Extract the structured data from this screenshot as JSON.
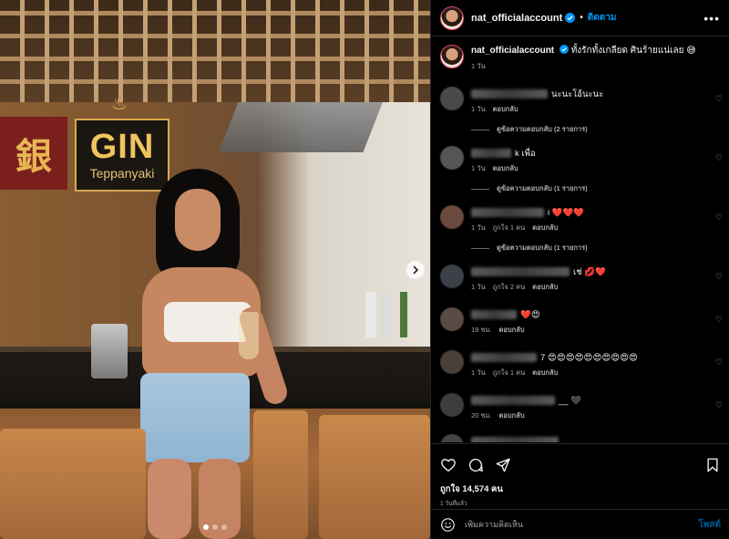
{
  "photo": {
    "sign_left_glyph": "銀",
    "sign_brand": "GIN",
    "sign_sub": "Teppanyaki",
    "carousel_dots": 3,
    "active_dot": 0,
    "next_icon": "chevron-right-icon"
  },
  "header": {
    "username": "nat_officialaccount",
    "separator": "•",
    "follow_label": "ติดตาม",
    "more_icon": "more-horizontal-icon"
  },
  "caption": {
    "username": "nat_officialaccount",
    "text": "ทั้งรักทั้งเกลียด ศินร้ายแน่เลย 😅",
    "time": "1 วัน"
  },
  "comments": [
    {
      "text": "นะนะโอ้นะนะ",
      "time": "1 วัน",
      "likes": "",
      "reply_label": "ตอบกลับ",
      "view_replies": "ดูข้อความตอบกลับ (2 รายการ)"
    },
    {
      "text": "k เพื่อ",
      "time": "1 วัน",
      "likes": "",
      "reply_label": "ตอบกลับ",
      "view_replies": "ดูข้อความตอบกลับ (1 รายการ)"
    },
    {
      "text": "i ❤️❤️❤️",
      "time": "1 วัน",
      "likes": "ถูกใจ 1 คน",
      "reply_label": "ตอบกลับ",
      "view_replies": "ดูข้อความตอบกลับ (1 รายการ)"
    },
    {
      "text": "เช่ 💋❤️",
      "time": "1 วัน",
      "likes": "ถูกใจ 2 คน",
      "reply_label": "ตอบกลับ",
      "view_replies": ""
    },
    {
      "text": "❤️😍",
      "time": "19 ชม.",
      "likes": "",
      "reply_label": "ตอบกลับ",
      "view_replies": ""
    },
    {
      "text": "7 😍😍😍😍😍😍😍😍😍😍",
      "time": "1 วัน",
      "likes": "ถูกใจ 1 คน",
      "reply_label": "ตอบกลับ",
      "view_replies": ""
    },
    {
      "text": "__ 🖤",
      "time": "20 ชม.",
      "likes": "",
      "reply_label": "ตอบกลับ",
      "view_replies": ""
    }
  ],
  "actions": {
    "like_icon": "heart-icon",
    "comment_icon": "comment-icon",
    "share_icon": "send-icon",
    "save_icon": "bookmark-icon",
    "likes": "ถูกใจ 14,574 คน",
    "posted": "1 วันที่แล้ว"
  },
  "add_comment": {
    "emoji_icon": "emoji-icon",
    "placeholder": "เพิ่มความคิดเห็น",
    "post_label": "โพสต์"
  },
  "colors": {
    "background": "#000000",
    "accent": "#0095f6",
    "muted": "#a8a8a8",
    "heart": "#ed4956"
  }
}
